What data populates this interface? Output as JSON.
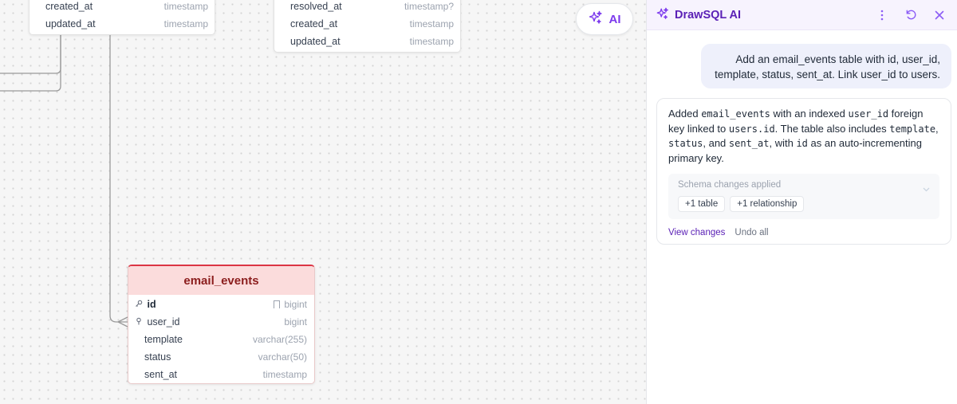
{
  "canvas": {
    "users_table": {
      "rows": [
        {
          "name": "created_at",
          "type": "timestamp"
        },
        {
          "name": "updated_at",
          "type": "timestamp"
        }
      ]
    },
    "tickets_table": {
      "rows": [
        {
          "name": "resolved_at",
          "type": "timestamp?"
        },
        {
          "name": "created_at",
          "type": "timestamp"
        },
        {
          "name": "updated_at",
          "type": "timestamp"
        }
      ]
    },
    "email_events": {
      "title": "email_events",
      "columns": [
        {
          "name": "id",
          "type": "bigint",
          "icon": "key-icon",
          "primary": true
        },
        {
          "name": "user_id",
          "type": "bigint",
          "icon": "foreign-key-icon"
        },
        {
          "name": "template",
          "type": "varchar(255)"
        },
        {
          "name": "status",
          "type": "varchar(50)"
        },
        {
          "name": "sent_at",
          "type": "timestamp"
        }
      ]
    },
    "ai_button_label": "AI",
    "accent_color": "#7c3aed",
    "header_color": "#fbdcdc"
  },
  "panel": {
    "title": "DrawSQL AI",
    "user_message": "Add an email_events table with id, user_id, template, status, sent_at. Link user_id to users.",
    "ai_response": {
      "segments": [
        {
          "t": "Added "
        },
        {
          "t": "email_events",
          "code": true
        },
        {
          "t": " with an indexed "
        },
        {
          "t": "user_id",
          "code": true
        },
        {
          "t": " foreign key linked to "
        },
        {
          "t": "users.id",
          "code": true
        },
        {
          "t": ". The table also includes "
        },
        {
          "t": "template",
          "code": true
        },
        {
          "t": ", "
        },
        {
          "t": "status",
          "code": true
        },
        {
          "t": ", and "
        },
        {
          "t": "sent_at",
          "code": true
        },
        {
          "t": ", with "
        },
        {
          "t": "id",
          "code": true
        },
        {
          "t": " as an auto-incrementing primary key."
        }
      ],
      "changes_title": "Schema changes applied",
      "chips": [
        "+1 table",
        "+1 relationship"
      ],
      "view_changes": "View changes",
      "undo_all": "Undo all"
    }
  }
}
